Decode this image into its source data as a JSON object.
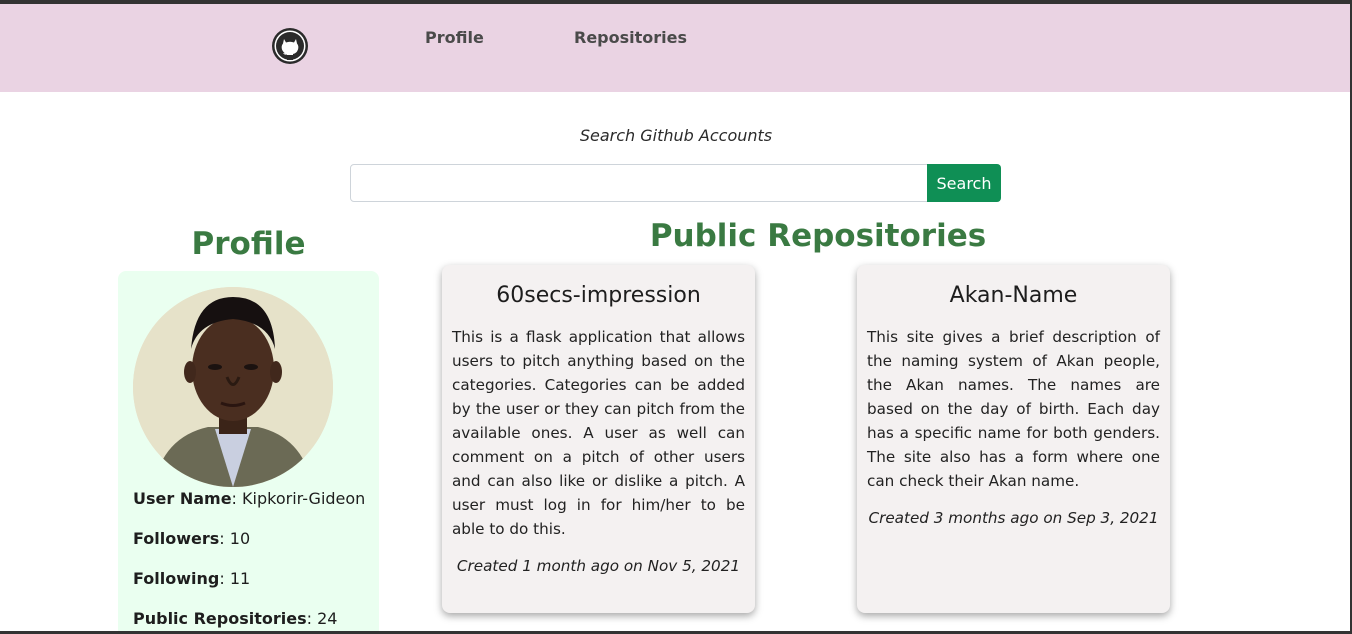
{
  "nav": {
    "logo_icon": "github-icon",
    "links": [
      "Profile",
      "Repositories"
    ]
  },
  "search": {
    "caption": "Search Github Accounts",
    "input_value": "",
    "button_label": "Search"
  },
  "profile": {
    "heading": "Profile",
    "avatar_icon": "user-avatar",
    "user_name_label": "User Name",
    "user_name": "Kipkorir-Gideon",
    "followers_label": "Followers",
    "followers": "10",
    "following_label": "Following",
    "following": "11",
    "public_repos_label": "Public Repositories",
    "public_repos": "24"
  },
  "repos": {
    "heading": "Public Repositories",
    "items": [
      {
        "name": "60secs-impression",
        "description": "This is a flask application that allows users to pitch anything based on the categories. Categories can be added by the user or they can pitch from the available ones. A user as well can comment on a pitch of other users and can also like or dislike a pitch. A user must log in for him/her to be able to do this.",
        "created": "Created 1 month ago on Nov 5, 2021"
      },
      {
        "name": "Akan-Name",
        "description": "This site gives a brief description of the naming system of Akan people, the Akan names. The names are based on the day of birth. Each day has a specific name for both genders. The site also has a form where one can check their Akan name.",
        "created": "Created 3 months ago on Sep 3, 2021"
      }
    ]
  },
  "colors": {
    "navbar_bg": "#ead3e3",
    "heading_green": "#3a7a42",
    "search_button": "#0f8f55",
    "profile_card_bg": "#eafff0",
    "repo_card_bg": "#f4f1f1"
  }
}
